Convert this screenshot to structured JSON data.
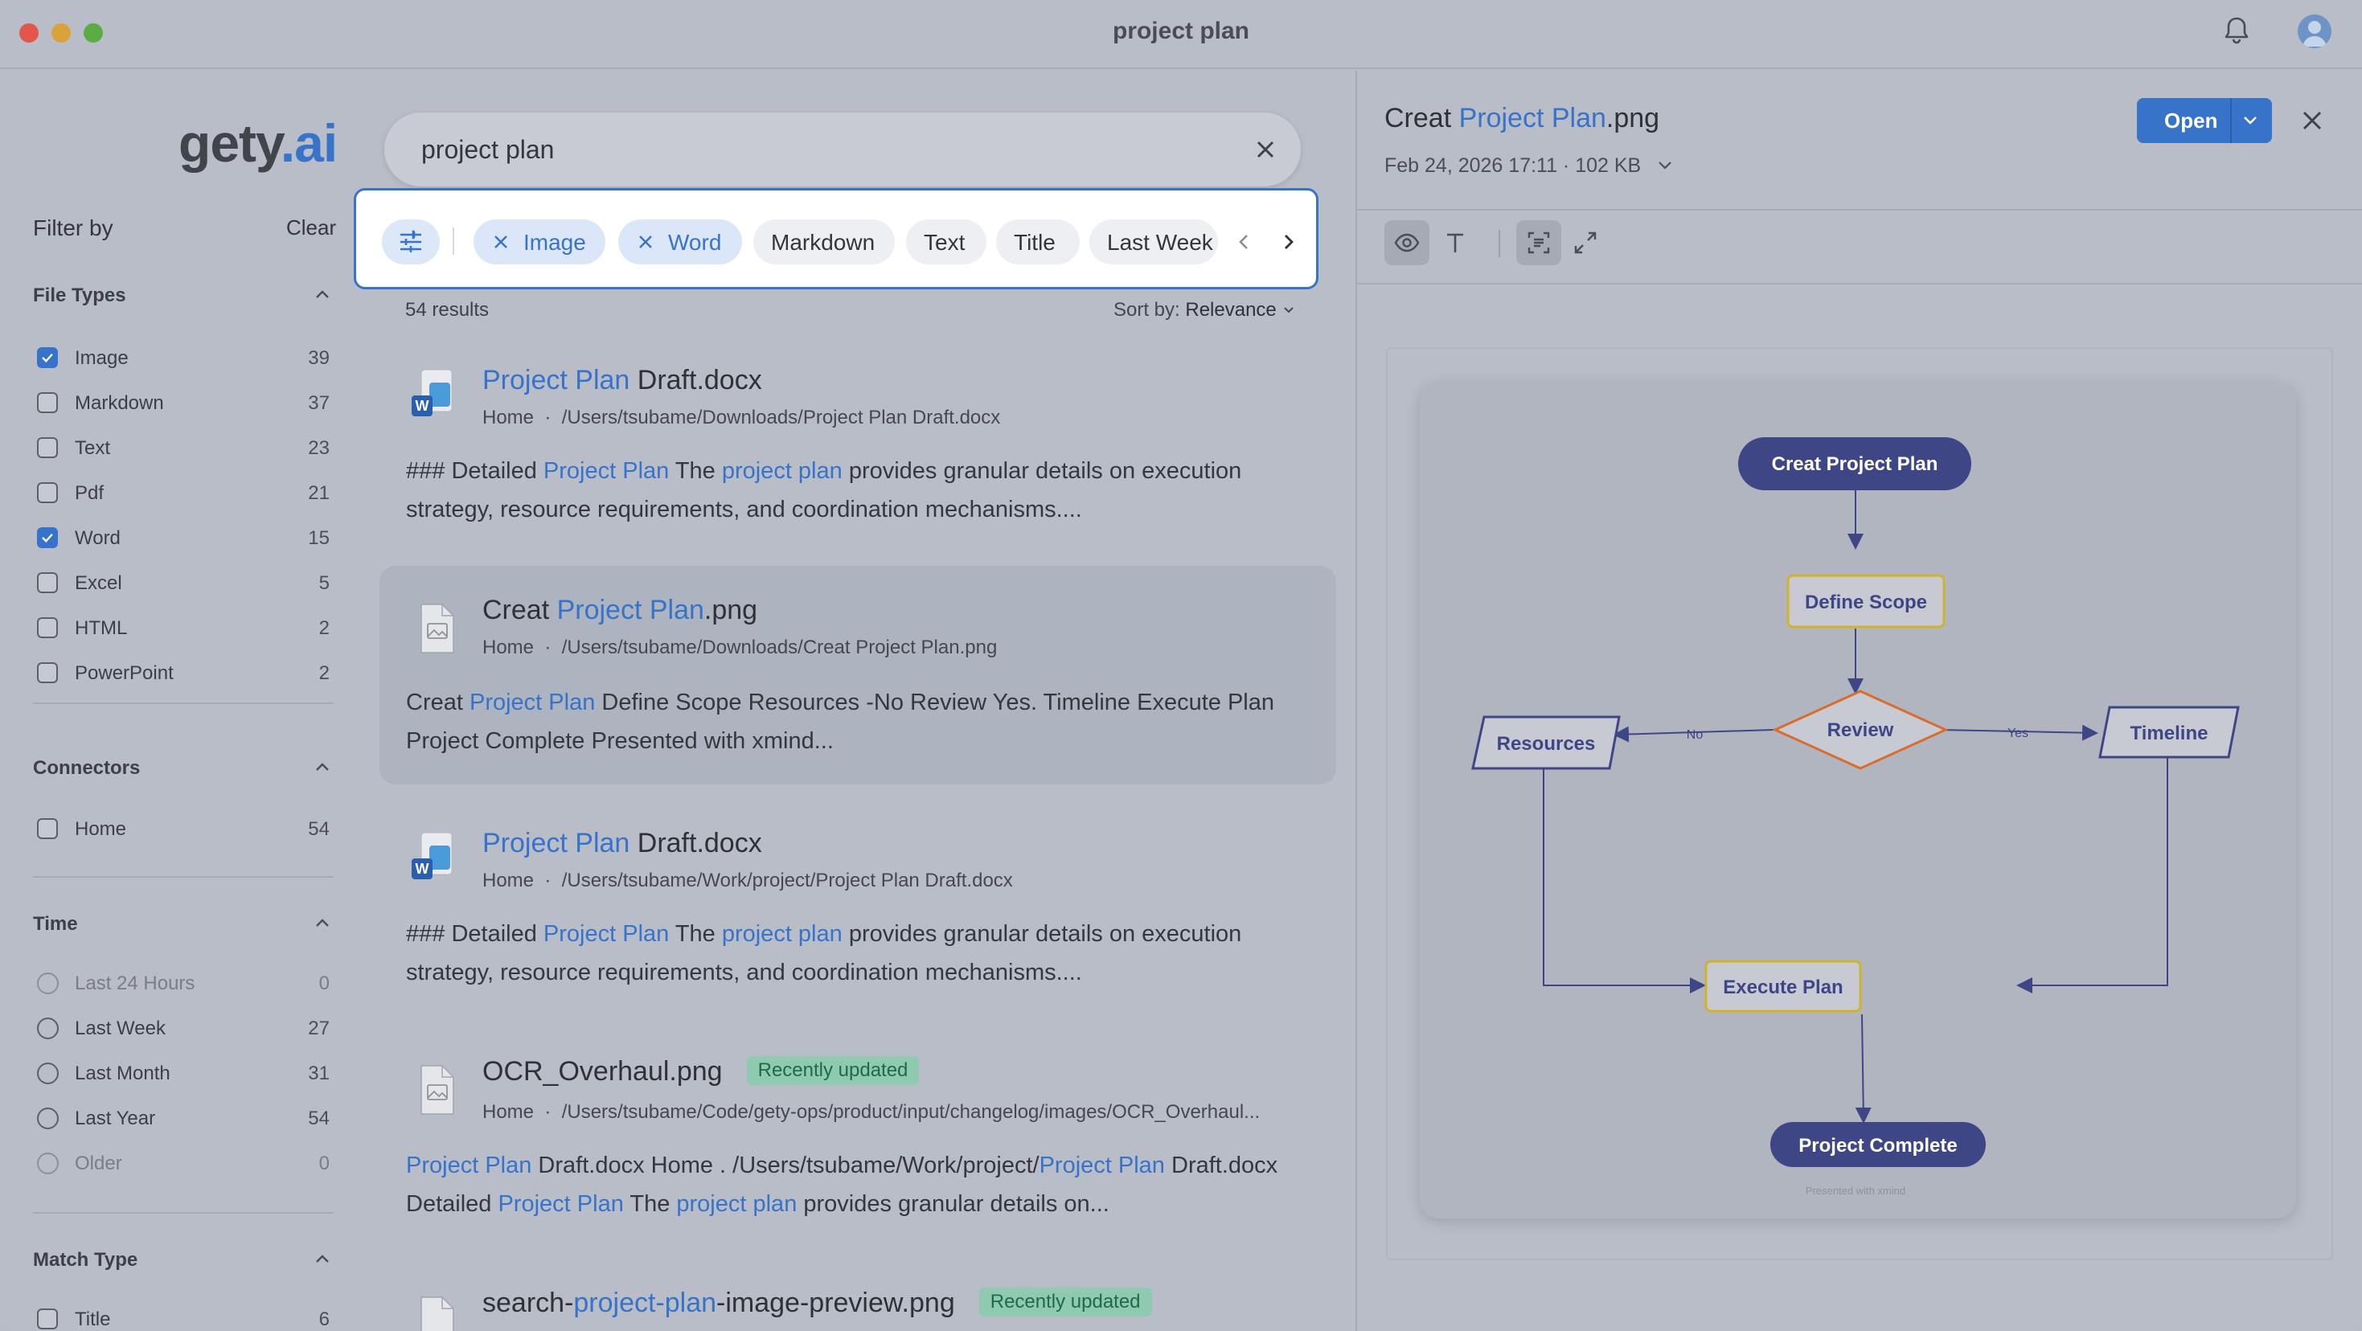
{
  "window": {
    "title": "project plan"
  },
  "colors": {
    "accent": "#3773c9",
    "badge_bg": "#8fcab0",
    "flow_node": "#3f4686",
    "flow_box_border": "#d1b32a",
    "flow_diamond": "#d96d2c"
  },
  "sidebar": {
    "logo_main": "gety",
    "logo_dot": ".ai",
    "filter_by": "Filter by",
    "clear": "Clear",
    "file_types": {
      "heading": "File Types",
      "items": [
        {
          "label": "Image",
          "count": "39",
          "checked": true
        },
        {
          "label": "Markdown",
          "count": "37",
          "checked": false
        },
        {
          "label": "Text",
          "count": "23",
          "checked": false
        },
        {
          "label": "Pdf",
          "count": "21",
          "checked": false
        },
        {
          "label": "Word",
          "count": "15",
          "checked": true
        },
        {
          "label": "Excel",
          "count": "5",
          "checked": false
        },
        {
          "label": "HTML",
          "count": "2",
          "checked": false
        },
        {
          "label": "PowerPoint",
          "count": "2",
          "checked": false
        }
      ]
    },
    "connectors": {
      "heading": "Connectors",
      "items": [
        {
          "label": "Home",
          "count": "54"
        }
      ]
    },
    "time": {
      "heading": "Time",
      "items": [
        {
          "label": "Last 24 Hours",
          "count": "0",
          "disabled": true
        },
        {
          "label": "Last Week",
          "count": "27",
          "disabled": false
        },
        {
          "label": "Last Month",
          "count": "31",
          "disabled": false
        },
        {
          "label": "Last Year",
          "count": "54",
          "disabled": false
        },
        {
          "label": "Older",
          "count": "0",
          "disabled": true
        }
      ]
    },
    "match_type": {
      "heading": "Match Type",
      "items": [
        {
          "label": "Title",
          "count": "6"
        }
      ]
    }
  },
  "search": {
    "value": "project plan"
  },
  "chips": [
    {
      "label": "Image",
      "selected": true
    },
    {
      "label": "Word",
      "selected": true
    },
    {
      "label": "Markdown",
      "selected": false
    },
    {
      "label": "Text",
      "selected": false
    },
    {
      "label": "Title",
      "selected": false
    },
    {
      "label": "Last Week",
      "selected": false
    }
  ],
  "results": {
    "count": "54 results",
    "sort_label": "Sort by:",
    "sort_value": "Relevance",
    "items": [
      {
        "title_hl": "Project Plan",
        "title_rest": " Draft.docx",
        "source": "Home",
        "path": "/Users/tsubame/Downloads/Project Plan Draft.docx",
        "snippet": {
          "a": "### Detailed ",
          "b": "Project Plan",
          "c": " The ",
          "d": "project plan",
          "e": " provides granular details on execution strategy, resource requirements, and coordination mechanisms...."
        }
      },
      {
        "title_pre": "Creat ",
        "title_hl": "Project Plan",
        "title_rest": ".png",
        "source": "Home",
        "path": "/Users/tsubame/Downloads/Creat Project Plan.png",
        "snippet": {
          "a": "Creat ",
          "b": "Project Plan",
          "c": " Define Scope Resources -No Review Yes. Timeline Execute Plan Project Complete Presented with xmind..."
        }
      },
      {
        "title_hl": "Project Plan",
        "title_rest": " Draft.docx",
        "source": "Home",
        "path": "/Users/tsubame/Work/project/Project Plan Draft.docx",
        "snippet": {
          "a": "### Detailed ",
          "b": "Project Plan",
          "c": " The ",
          "d": "project plan",
          "e": " provides granular details on execution strategy, resource requirements, and coordination mechanisms...."
        }
      },
      {
        "title": "OCR_Overhaul.png",
        "badge": "Recently updated",
        "source": "Home",
        "path": "/Users/tsubame/Code/gety-ops/product/input/changelog/images/OCR_Overhaul...",
        "snippet": {
          "a": "Project Plan",
          "b": " Draft.docx Home . /Users/tsubame/Work/project/",
          "c": "Project Plan",
          "d": " Draft.docx Detailed ",
          "e": "Project Plan",
          "f": " The ",
          "g": "project plan",
          "h": " provides granular details on..."
        }
      },
      {
        "title_pre": "search-",
        "title_hl": "project-plan",
        "title_rest": "-image-preview.png",
        "badge": "Recently updated"
      }
    ]
  },
  "preview": {
    "title_pre": "Creat ",
    "title_hl": "Project Plan",
    "title_rest": ".png",
    "meta": "Feb 24, 2026 17:11 · 102 KB",
    "open": "Open",
    "diagram": {
      "start": "Creat Project Plan",
      "scope": "Define Scope",
      "review": "Review",
      "resources": "Resources",
      "timeline": "Timeline",
      "execute": "Execute Plan",
      "complete": "Project Complete",
      "no": "No",
      "yes": "Yes",
      "footer": "Presented with xmind"
    }
  }
}
